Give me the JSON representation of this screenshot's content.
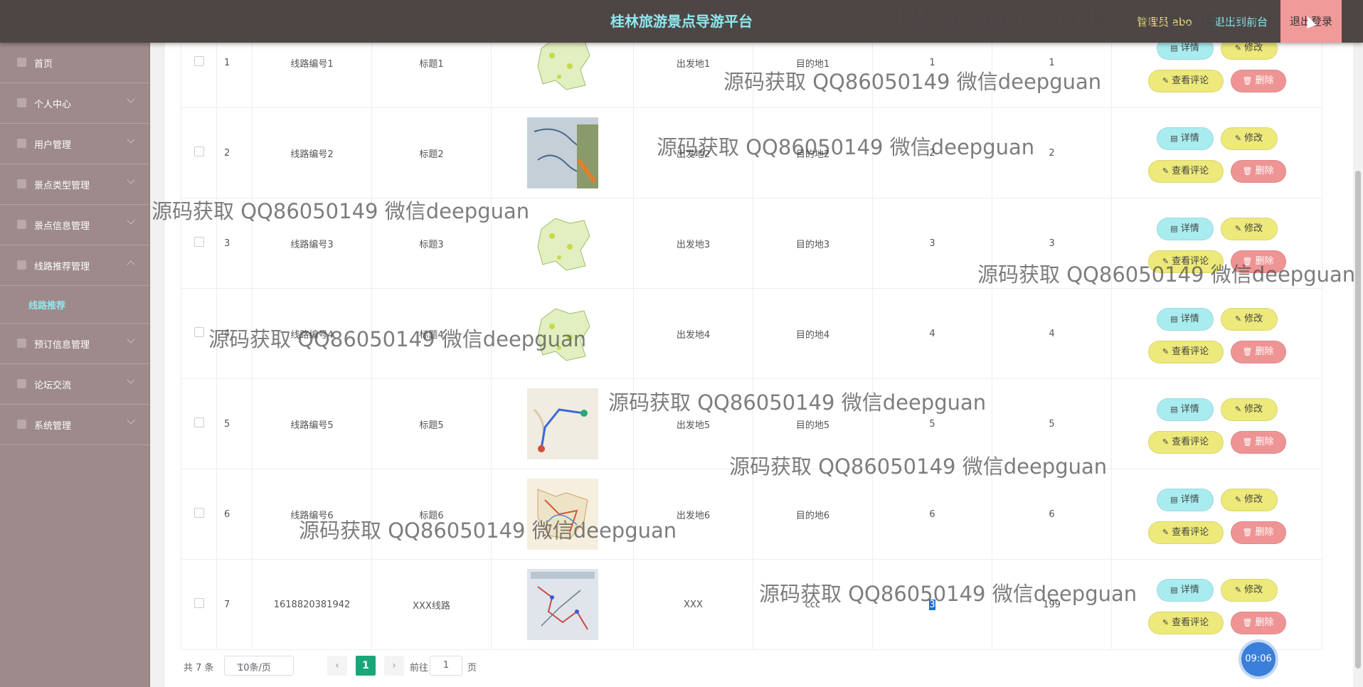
{
  "header": {
    "title": "桂林旅游景点导游平台",
    "admin_label": "管理员 abo",
    "front_label": "退出到前台",
    "logout_label": "退出登录"
  },
  "sidebar": {
    "items": [
      {
        "label": "首页",
        "icon": "home-icon"
      },
      {
        "label": "个人中心",
        "icon": "user-icon"
      },
      {
        "label": "用户管理",
        "icon": "users-icon"
      },
      {
        "label": "景点类型管理",
        "icon": "bar-chart-icon"
      },
      {
        "label": "景点信息管理",
        "icon": "send-icon"
      },
      {
        "label": "线路推荐管理",
        "icon": "route-icon"
      },
      {
        "label": "预订信息管理",
        "icon": "ticket-icon"
      },
      {
        "label": "论坛交流",
        "icon": "chat-icon"
      },
      {
        "label": "系统管理",
        "icon": "gear-icon"
      }
    ],
    "active_sub": "线路推荐"
  },
  "table": {
    "rows": [
      {
        "idx": "1",
        "code": "线路编号1",
        "title": "标题1",
        "from": "出发地1",
        "to": "目的地1",
        "c1": "1",
        "c2": "1"
      },
      {
        "idx": "2",
        "code": "线路编号2",
        "title": "标题2",
        "from": "出发地2",
        "to": "目的地2",
        "c1": "2",
        "c2": "2"
      },
      {
        "idx": "3",
        "code": "线路编号3",
        "title": "标题3",
        "from": "出发地3",
        "to": "目的地3",
        "c1": "3",
        "c2": "3"
      },
      {
        "idx": "4",
        "code": "线路编号4",
        "title": "标题4",
        "from": "出发地4",
        "to": "目的地4",
        "c1": "4",
        "c2": "4"
      },
      {
        "idx": "5",
        "code": "线路编号5",
        "title": "标题5",
        "from": "出发地5",
        "to": "目的地5",
        "c1": "5",
        "c2": "5"
      },
      {
        "idx": "6",
        "code": "线路编号6",
        "title": "标题6",
        "from": "出发地6",
        "to": "目的地6",
        "c1": "6",
        "c2": "6"
      },
      {
        "idx": "7",
        "code": "1618820381942",
        "title": "XXX线路",
        "from": "XXX",
        "to": "ccc",
        "c1": "3",
        "c2": "199"
      }
    ],
    "actions": {
      "detail": "详情",
      "edit": "修改",
      "comment": "查看评论",
      "delete": "删除"
    }
  },
  "pager": {
    "total": "共 7 条",
    "page_size": "10条/页",
    "current": "1",
    "goto_label": "前往",
    "goto_value": "1",
    "page_unit": "页"
  },
  "clock": "09:06",
  "watermark": "源码获取 QQ86050149 微信deepguan",
  "colors": {
    "header_bg": "#4e4645",
    "title": "#8fe8ef",
    "sidebar_bg": "#9e8a8a",
    "detail_btn": "#a9ecef",
    "edit_btn": "#ede97a",
    "delete_btn": "#ef9494",
    "pager_active": "#16a878"
  }
}
